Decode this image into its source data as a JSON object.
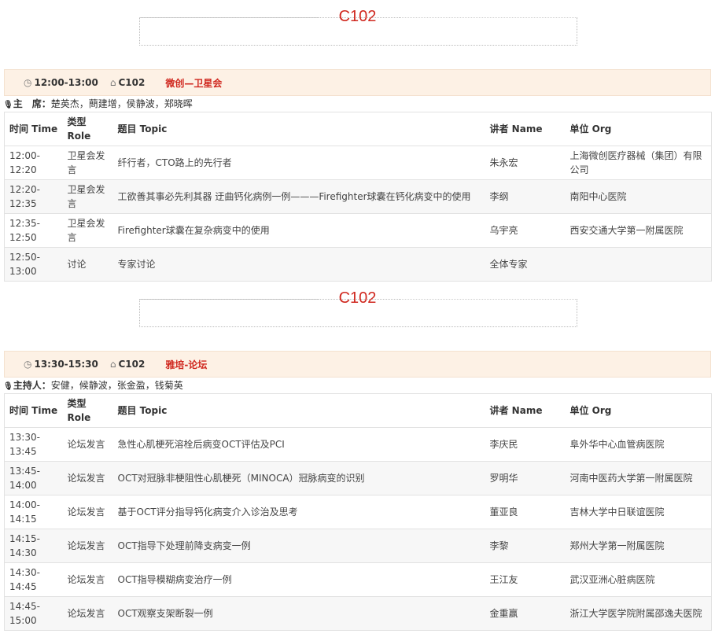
{
  "sessions": [
    {
      "room_title": "C102",
      "time": "12:00-13:00",
      "room": "C102",
      "name": "微创—卫星会",
      "chair_label": "主　席：",
      "chair_names": "楚英杰，蔄建增，侯静波，郑晓晖",
      "headers": [
        "时间 Time",
        "类型 Role",
        "题目 Topic",
        "讲者 Name",
        "单位 Org"
      ],
      "rows": [
        [
          "12:00-12:20",
          "卫星会发言",
          "纤行者，CTO路上的先行者",
          "朱永宏",
          "上海微创医疗器械（集团）有限公司"
        ],
        [
          "12:20-12:35",
          "卫星会发言",
          "工欲善其事必先利其器 迂曲钙化病例一例———Firefighter球囊在钙化病变中的使用",
          "李纲",
          "南阳中心医院"
        ],
        [
          "12:35-12:50",
          "卫星会发言",
          "Firefighter球囊在复杂病变中的使用",
          "乌宇亮",
          "西安交通大学第一附属医院"
        ],
        [
          "12:50-13:00",
          "讨论",
          "专家讨论",
          "全体专家",
          ""
        ]
      ]
    },
    {
      "room_title": "C102",
      "time": "13:30-15:30",
      "room": "C102",
      "name": "雅培-论坛",
      "chair_label": "主持人：",
      "chair_names": "安健，候静波，张金盈，钱菊英",
      "headers": [
        "时间 Time",
        "类型 Role",
        "题目 Topic",
        "讲者 Name",
        "单位 Org"
      ],
      "rows": [
        [
          "13:30-13:45",
          "论坛发言",
          "急性心肌梗死溶栓后病变OCT评估及PCI",
          "李庆民",
          "阜外华中心血管病医院"
        ],
        [
          "13:45-14:00",
          "论坛发言",
          "OCT对冠脉非梗阻性心肌梗死（MINOCA）冠脉病变的识别",
          "罗明华",
          "河南中医药大学第一附属医院"
        ],
        [
          "14:00-14:15",
          "论坛发言",
          "基于OCT评分指导钙化病变介入诊治及思考",
          "董亚良",
          "吉林大学中日联谊医院"
        ],
        [
          "14:15-14:30",
          "论坛发言",
          "OCT指导下处理前降支病变一例",
          "李黎",
          "郑州大学第一附属医院"
        ],
        [
          "14:30-14:45",
          "论坛发言",
          "OCT指导模糊病变治疗一例",
          "王江友",
          "武汉亚洲心脏病医院"
        ],
        [
          "14:45-15:00",
          "论坛发言",
          "OCT观察支架断裂一例",
          "金重赢",
          "浙江大学医学院附属邵逸夫医院"
        ]
      ]
    }
  ],
  "icons": {
    "time": "clock-icon",
    "room": "home-icon",
    "chair": "microphone-icon"
  }
}
